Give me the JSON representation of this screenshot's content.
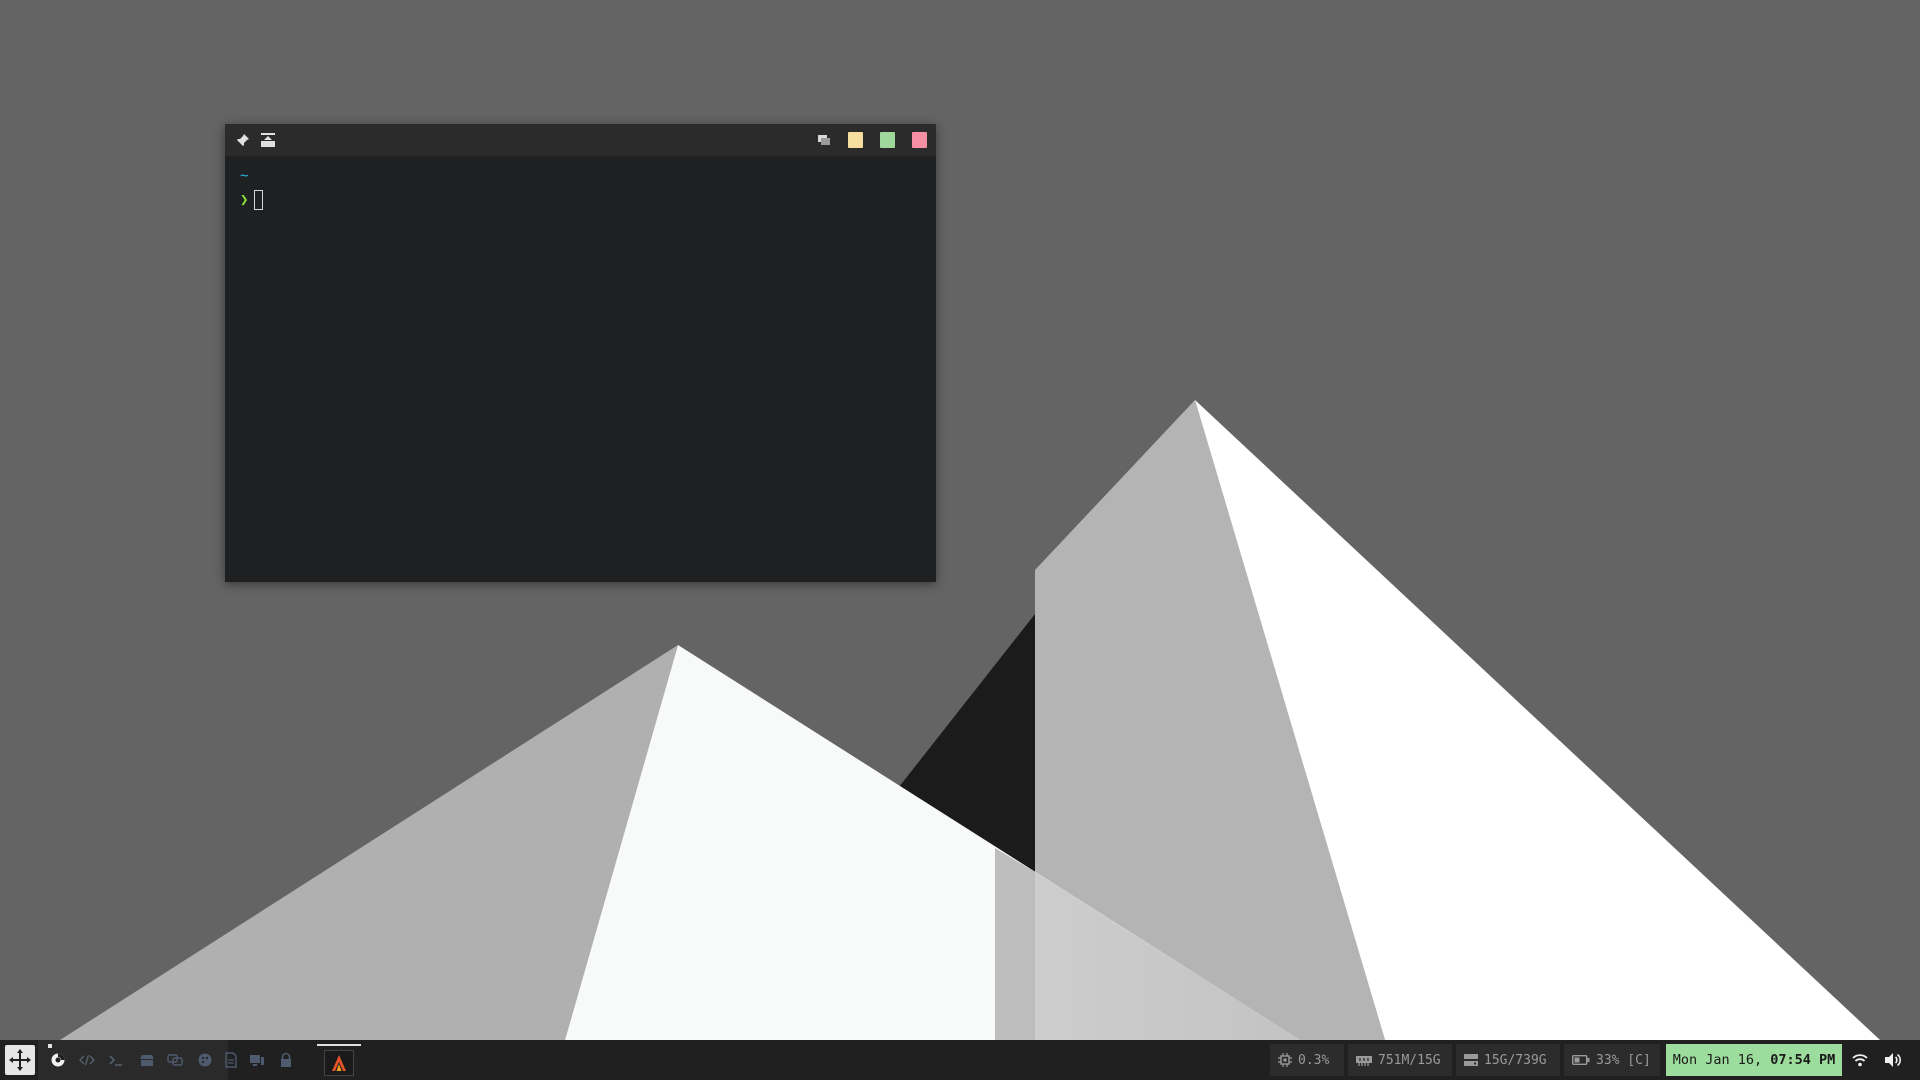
{
  "terminal": {
    "cwd": "~",
    "prompt_symbol": "❯",
    "titlebar_swatches": [
      {
        "name": "yellow",
        "color": "#f7dfa0"
      },
      {
        "name": "green",
        "color": "#9ed89a"
      },
      {
        "name": "pink",
        "color": "#f58fa4"
      }
    ]
  },
  "taskbar": {
    "workspaces": [
      "browser-icon",
      "code-icon",
      "terminal-icon",
      "store-icon",
      "chat-icon",
      "palette-icon",
      "document-icon",
      "devices-icon",
      "lock-icon"
    ],
    "cpu": "0.3%",
    "memory": "751M/15G",
    "disk": "15G/739G",
    "battery": "33% [C]",
    "clock_date": "Mon Jan 16, ",
    "clock_time": "07:54 PM"
  },
  "colors": {
    "desktop_bg": "#646464",
    "terminal_bg": "#1f2022",
    "taskbar_bg": "#202020",
    "clock_bg": "#9cdc9c",
    "accent_app": "#e6542a"
  }
}
